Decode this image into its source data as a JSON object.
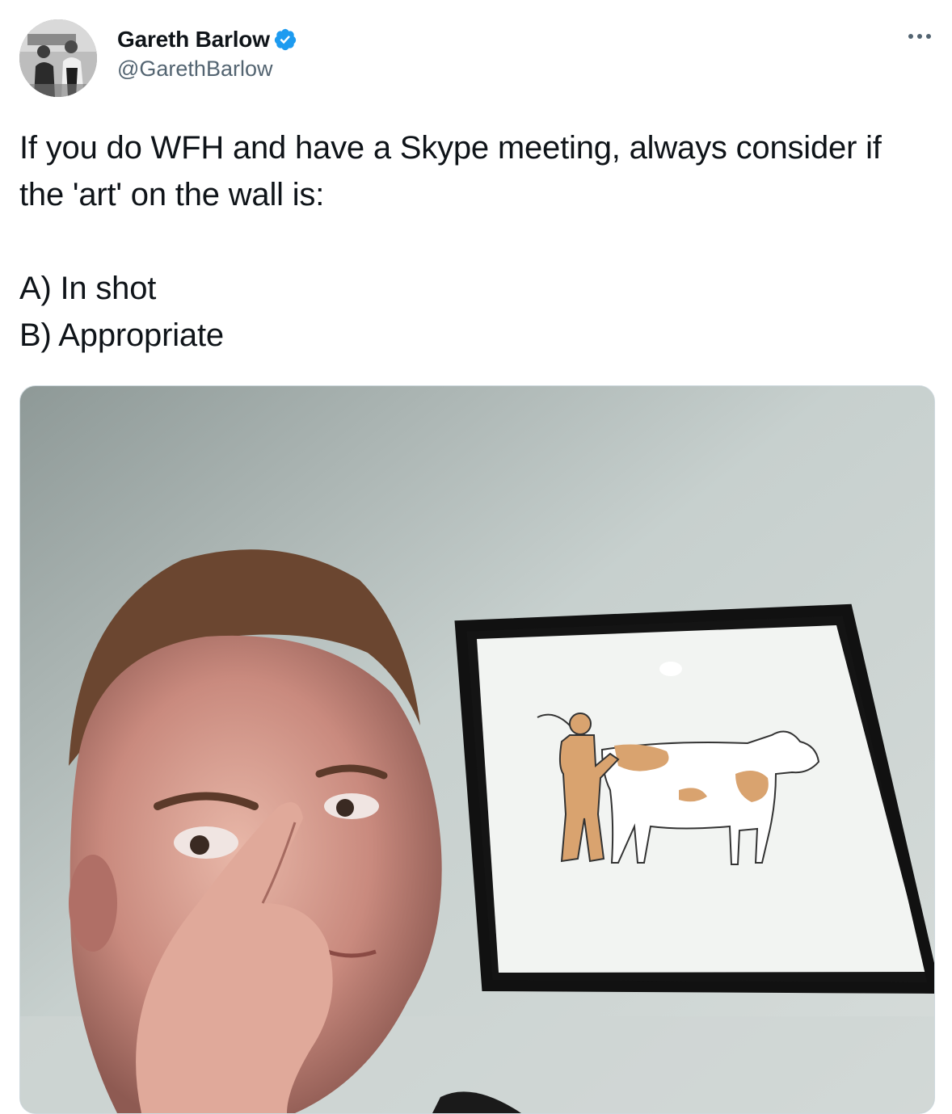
{
  "author": {
    "display_name": "Gareth Barlow",
    "handle": "@GarethBarlow",
    "verified": true,
    "avatar_icon": "user-avatar-photo"
  },
  "tweet": {
    "text": "If you do WFH and have a Skype meeting, always consider if the 'art' on the wall is:\n\nA) In shot\nB) Appropriate"
  },
  "actions": {
    "more_icon": "more-horizontal-icon"
  },
  "media": {
    "type": "photo",
    "icon": "attached-photo"
  },
  "colors": {
    "text_primary": "#0f1419",
    "text_secondary": "#536471",
    "verified_blue": "#1d9bf0",
    "border": "#cfd9de"
  }
}
